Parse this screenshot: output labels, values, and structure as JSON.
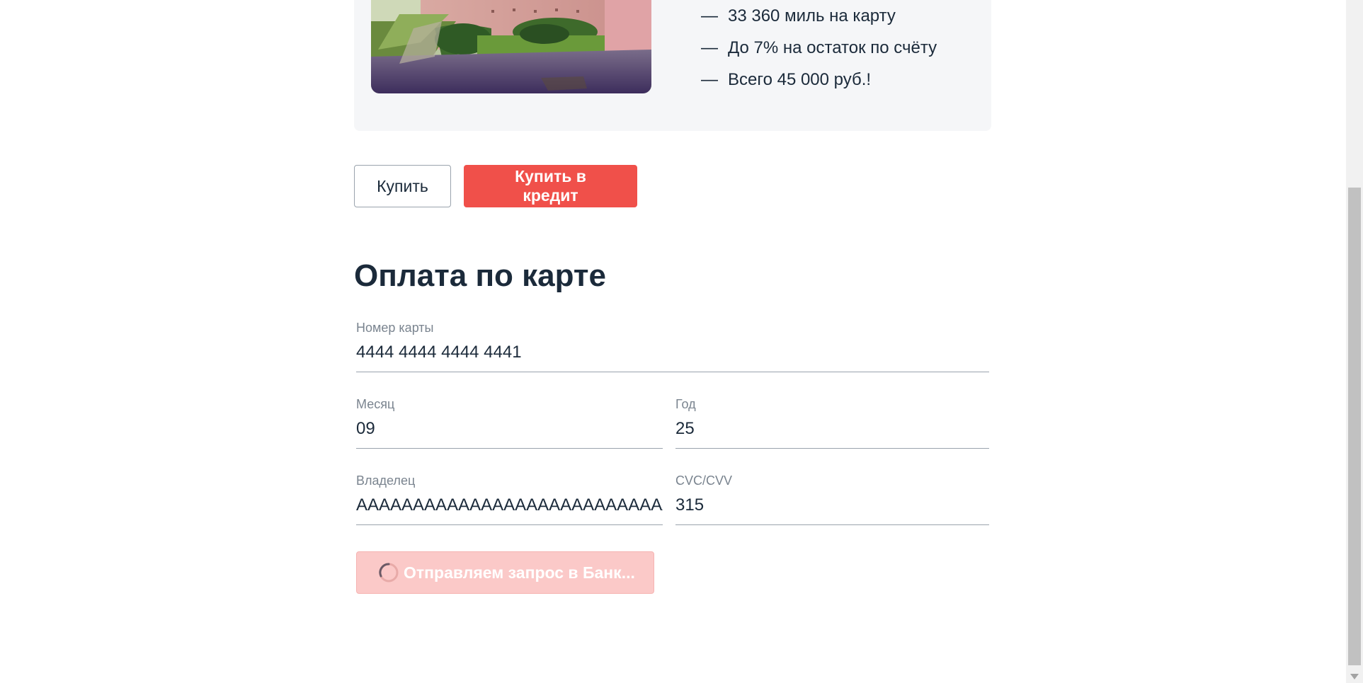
{
  "tour": {
    "photo_alt": "tour-photo",
    "features": [
      {
        "dash": "—",
        "text": "33 360 миль на карту"
      },
      {
        "dash": "—",
        "text": "До 7% на остаток по счёту"
      },
      {
        "dash": "—",
        "text": "Всего 45 000 руб.!"
      }
    ]
  },
  "buttons": {
    "buy_label": "Купить",
    "buy_credit_label": "Купить в кредит"
  },
  "payment": {
    "title": "Оплата по карте",
    "card_number": {
      "label": "Номер карты",
      "value": "4444 4444 4444 4441"
    },
    "month": {
      "label": "Месяц",
      "value": "09"
    },
    "year": {
      "label": "Год",
      "value": "25"
    },
    "owner": {
      "label": "Владелец",
      "value": "АААААААААААААААААААААААААААААААААААААААААААААААААААА"
    },
    "cvc": {
      "label": "CVC/CVV",
      "value": "315"
    },
    "submit_label": "Отправляем запрос в Банк...",
    "submit_state": "loading"
  },
  "colors": {
    "accent": "#f0504a",
    "accent_disabled": "#fbc9c8",
    "text": "#1b2a3a",
    "label": "#7a848f",
    "card_bg": "#f5f6f8"
  }
}
